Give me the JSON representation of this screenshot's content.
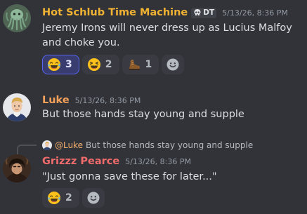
{
  "messages": [
    {
      "username": "Hot Schlub Time Machine",
      "username_color": "#f0b232",
      "tag": "DT",
      "timestamp": "5/13/26, 8:36 PM",
      "lines": [
        "Jeremy Irons will never dress up as Lucius Malfoy",
        "and choke you."
      ],
      "reactions": [
        {
          "emoji": "joy-emoji",
          "count": "3",
          "active": true
        },
        {
          "emoji": "laughing-emoji",
          "count": "2",
          "active": false
        },
        {
          "emoji": "shoe-emoji",
          "count": "1",
          "active": false
        }
      ]
    },
    {
      "username": "Luke",
      "username_color": "#f5a15a",
      "timestamp": "5/13/26, 8:36 PM",
      "lines": [
        "But those hands stay young and supple"
      ]
    },
    {
      "reply": {
        "mention": "@Luke",
        "text": "But those hands stay young and supple"
      },
      "username": "Grizzz Pearce",
      "username_color": "#f06b6b",
      "timestamp": "5/13/26, 8:36 PM",
      "lines": [
        "\"Just gonna save these for later...\""
      ],
      "reactions": [
        {
          "emoji": "joy-emoji",
          "count": "2",
          "active": false
        }
      ]
    }
  ]
}
